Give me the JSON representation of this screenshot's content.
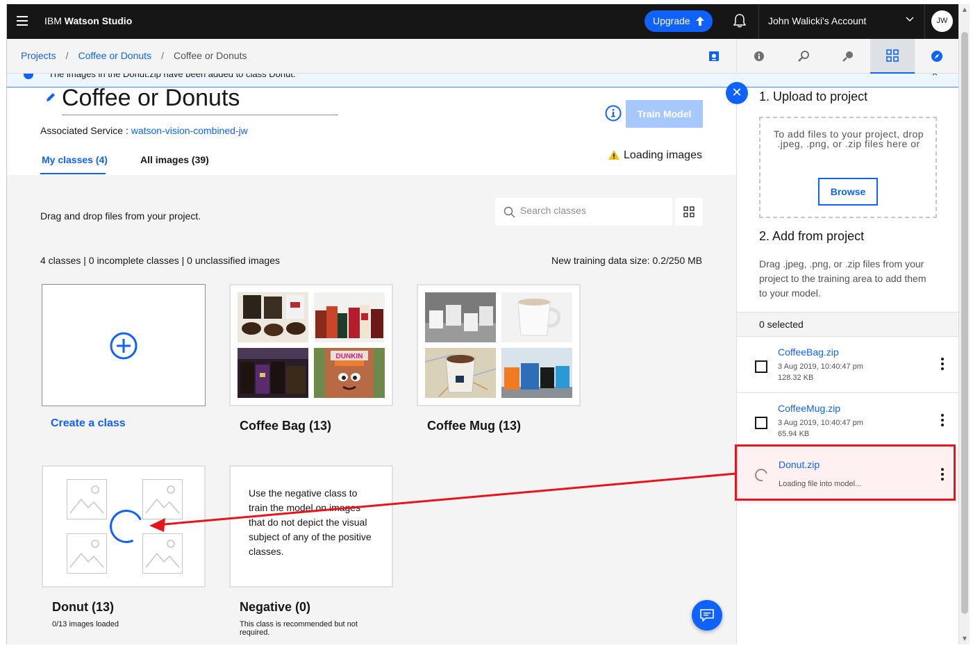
{
  "topbar": {
    "brand_prefix": "IBM",
    "brand_name": "Watson Studio",
    "upgrade_label": "Upgrade",
    "account_name": "John Walicki's Account",
    "avatar_initials": "JW"
  },
  "breadcrumb": {
    "items": [
      "Projects",
      "Coffee or Donuts",
      "Coffee or Donuts"
    ],
    "separator": "/"
  },
  "notification": {
    "text": "The images in the Donut.zip have been added to class Donut."
  },
  "model": {
    "title": "Coffee or Donuts",
    "train_label": "Train Model",
    "service_label": "Associated Service :",
    "service_name": "watson-vision-combined-jw"
  },
  "tabs": [
    {
      "label": "My classes (4)",
      "active": true
    },
    {
      "label": "All images (39)",
      "active": false
    }
  ],
  "loading_status": "Loading images",
  "area": {
    "drag_hint": "Drag and drop files from your project.",
    "search_placeholder": "Search classes",
    "stats": "4 classes | 0 incomplete classes | 0 unclassified images",
    "datasize_label": "New training data size:",
    "datasize_value": "0.2/250 MB"
  },
  "classes": {
    "create_label": "Create a class",
    "coffee_bag": {
      "name": "Coffee Bag (13)"
    },
    "coffee_mug": {
      "name": "Coffee Mug (13)"
    },
    "donut": {
      "name": "Donut (13)",
      "sub": "0/13 images loaded"
    },
    "negative": {
      "name": "Negative (0)",
      "description": "Use the negative class to train the model on images that do not depict the visual subject of any of the positive classes.",
      "sub": "This class is recommended but not required."
    }
  },
  "right_panel": {
    "upload_title": "1. Upload to project",
    "dropzone_text": "To add files to your project, drop .jpeg, .png, or .zip files here or",
    "browse_label": "Browse",
    "add_title": "2. Add from project",
    "add_desc": "Drag .jpeg, .png, or .zip files from your project to the training area to add them to your model.",
    "selected_count": "0 selected",
    "files": [
      {
        "name": "CoffeeBag.zip",
        "date": "3 Aug 2019, 10:40:47 pm",
        "size": "128.32 KB"
      },
      {
        "name": "CoffeeMug.zip",
        "date": "3 Aug 2019, 10:40:47 pm",
        "size": "65.94 KB"
      },
      {
        "name": "Donut.zip",
        "status": "Loading file into model..."
      }
    ]
  },
  "colors": {
    "accent": "#0f62fe",
    "annotation": "#e8141b",
    "topbar": "#161616"
  }
}
